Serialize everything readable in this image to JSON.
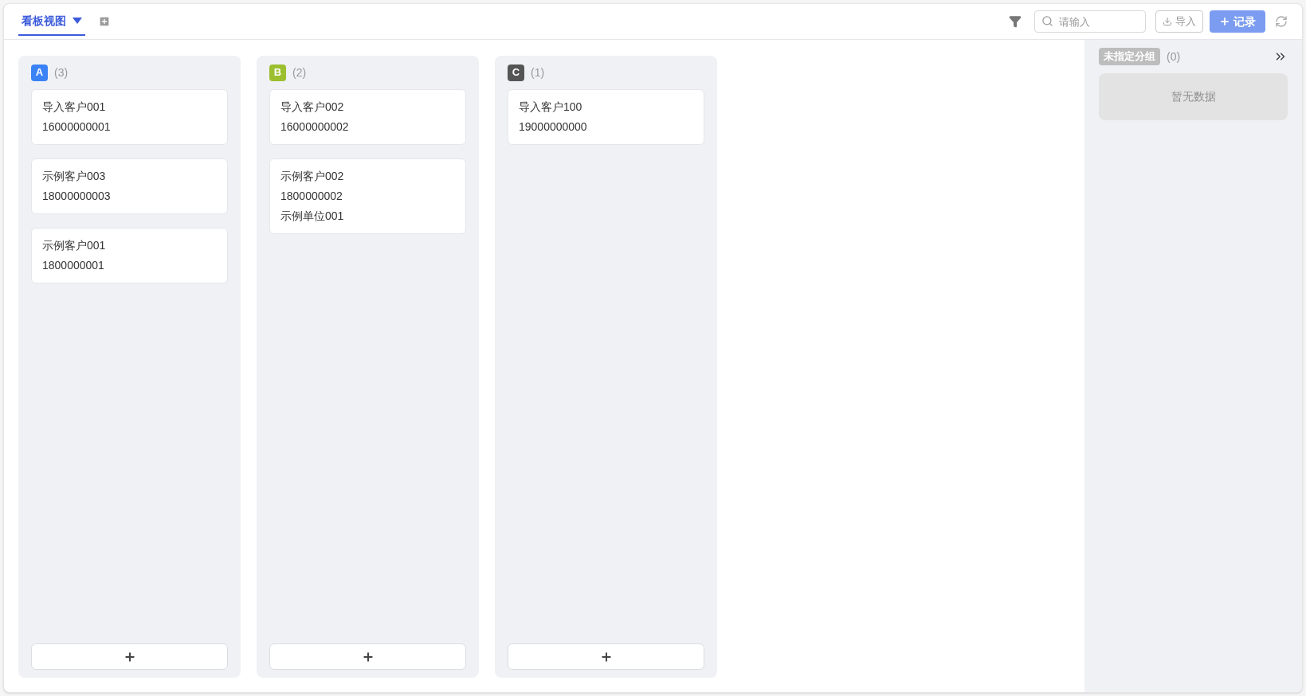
{
  "toolbar": {
    "view_tab": {
      "label": "看板视图",
      "selected": true
    },
    "search": {
      "placeholder": "请输入"
    },
    "import_button": "导入",
    "record_button": "记录"
  },
  "columns": [
    {
      "badge": "A",
      "color": "#3b82f6",
      "count": "(3)",
      "cards": [
        {
          "lines": [
            "导入客户001",
            "16000000001"
          ]
        },
        {
          "lines": [
            "示例客户003",
            "18000000003"
          ]
        },
        {
          "lines": [
            "示例客户001",
            "1800000001"
          ]
        }
      ]
    },
    {
      "badge": "B",
      "color": "#9bbf2e",
      "count": "(2)",
      "cards": [
        {
          "lines": [
            "导入客户002",
            "16000000002"
          ]
        },
        {
          "lines": [
            "示例客户002",
            "1800000002",
            "示例单位001"
          ]
        }
      ]
    },
    {
      "badge": "C",
      "color": "#555555",
      "count": "(1)",
      "cards": [
        {
          "lines": [
            "导入客户100",
            "19000000000"
          ]
        }
      ]
    }
  ],
  "unassigned": {
    "label": "未指定分组",
    "count": "(0)",
    "empty_text": "暂无数据"
  }
}
